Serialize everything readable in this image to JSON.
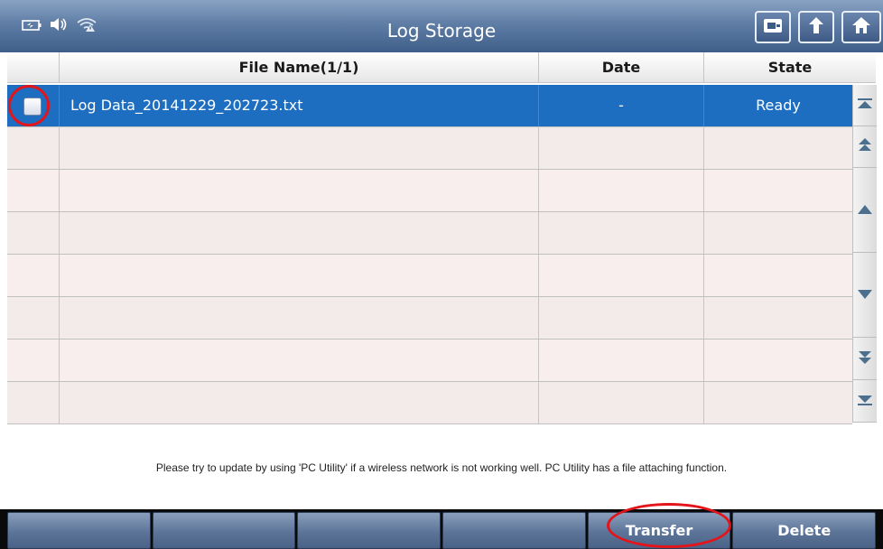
{
  "window": {
    "title": "Log Storage",
    "status_icons": [
      "battery-icon",
      "speaker-icon",
      "wifi-warning-icon"
    ],
    "toolbar_buttons": [
      "screen-capture-icon",
      "back-arrow-icon",
      "home-icon"
    ]
  },
  "table": {
    "headers": {
      "file_name": "File Name(1/1)",
      "date": "Date",
      "state": "State"
    },
    "rows": [
      {
        "file_name": "Log Data_20141229_202723.txt",
        "date": "-",
        "state": "Ready",
        "selected": true,
        "checked": false
      }
    ],
    "empty_rows": 7
  },
  "scroll_buttons": [
    "scroll-top-icon",
    "page-up-icon",
    "line-up-icon",
    "line-down-icon",
    "page-down-icon",
    "scroll-bottom-icon"
  ],
  "notice": "Please try to update by using 'PC Utility' if a wireless network is not working well. PC Utility has a file attaching function.",
  "bottom_bar": {
    "buttons": [
      "",
      "",
      "",
      "",
      "Transfer",
      "Delete"
    ]
  },
  "colors": {
    "selected_row": "#1d6dc0",
    "annotation": "#e3141a",
    "title_bar": "#5f7da5"
  }
}
